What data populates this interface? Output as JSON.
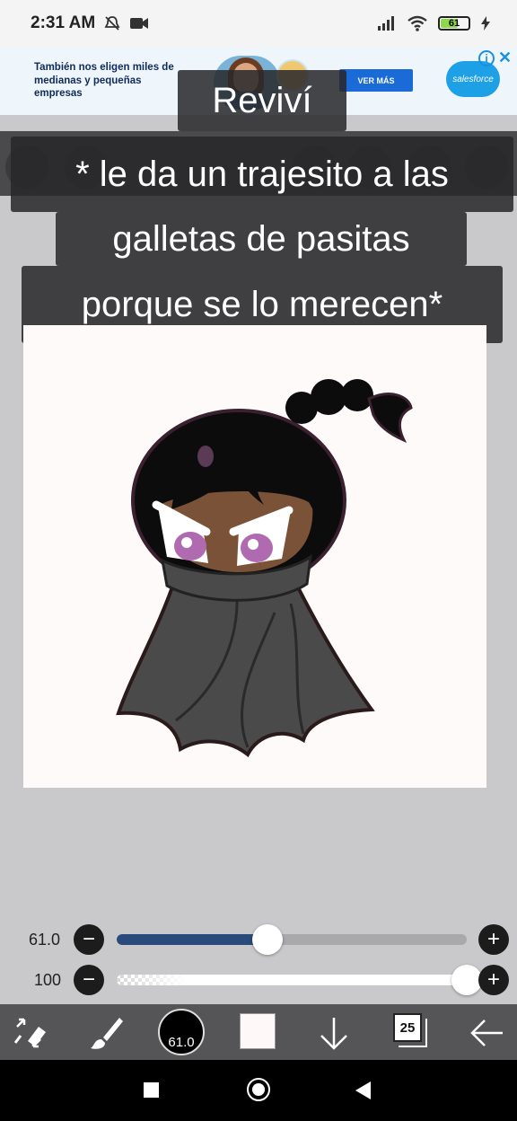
{
  "status_bar": {
    "time": "2:31 AM",
    "battery_level": "61"
  },
  "ad": {
    "text": "También nos eligen miles de medianas y pequeñas empresas",
    "button_label": "VER MÁS",
    "brand": "salesforce",
    "info_label": "i",
    "close_label": "✕"
  },
  "captions": {
    "top": "Reviví",
    "line1": "* le da un trajesito a las",
    "line2": "galletas de pasitas",
    "line3": "porque se lo merecen*"
  },
  "sliders": {
    "brush_size": {
      "label": "61.0",
      "value": 0.43,
      "minus": "−",
      "plus": "+"
    },
    "opacity": {
      "label": "100",
      "value": 1.0,
      "minus": "−",
      "plus": "+"
    }
  },
  "toolbar": {
    "brush_size_label": "61.0",
    "layer_count": "25",
    "primary_color": "#fff8f8"
  },
  "colors": {
    "slider_fill": "#294a7a",
    "toolbar_bg": "#555558",
    "background": "#c9c9cc"
  }
}
